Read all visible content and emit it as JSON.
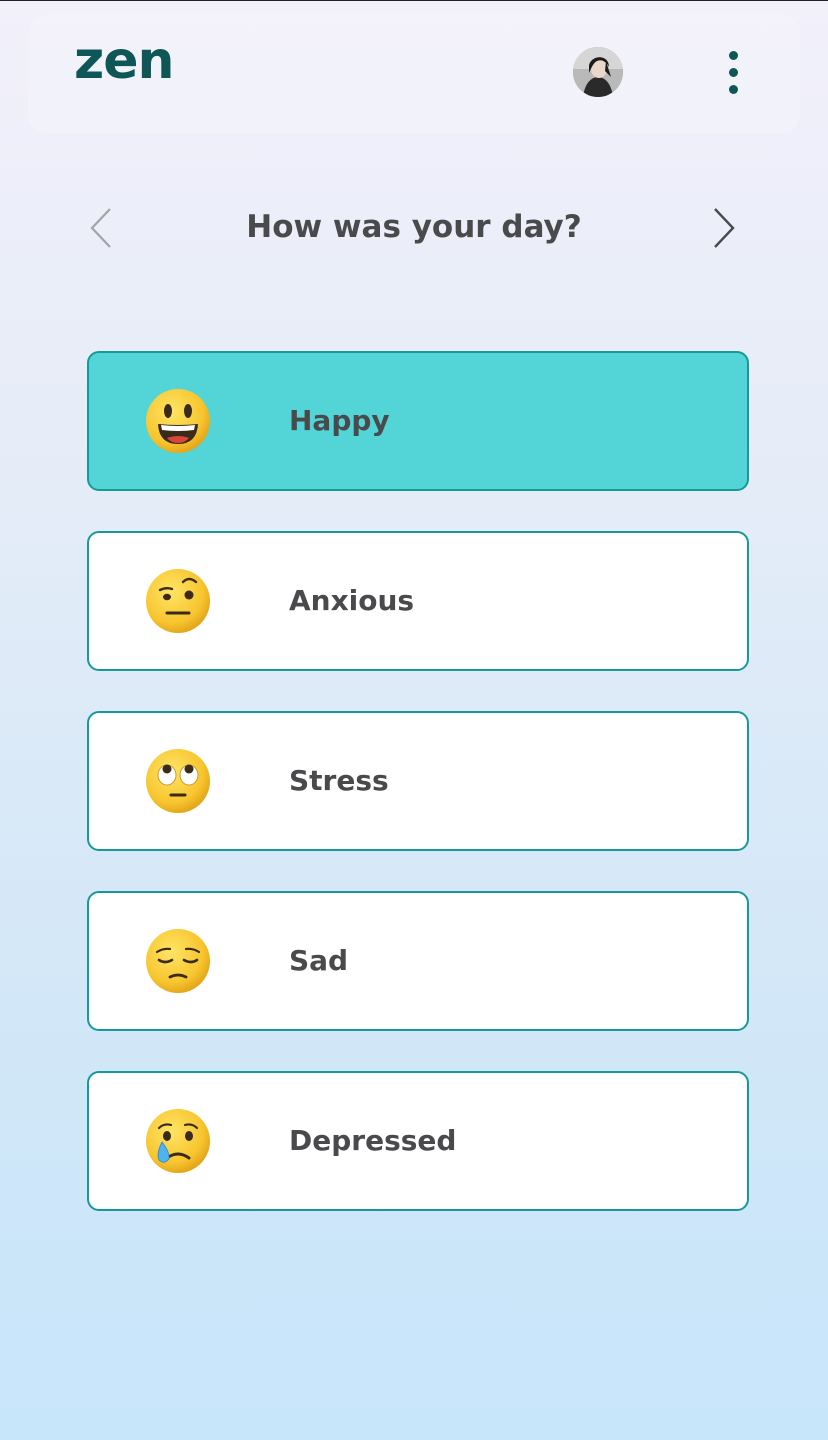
{
  "app": {
    "logo_text": "zen"
  },
  "header": {
    "avatar": "user-avatar-photo",
    "menu_icon": "kebab-menu-icon"
  },
  "prompt": {
    "question": "How was your day?",
    "prev_icon": "chevron-left-icon",
    "next_icon": "chevron-right-icon"
  },
  "moods": [
    {
      "label": "Happy",
      "icon": "grinning-face-emoji",
      "selected": true
    },
    {
      "label": "Anxious",
      "icon": "raised-eyebrow-face-emoji",
      "selected": false
    },
    {
      "label": "Stress",
      "icon": "rolling-eyes-face-emoji",
      "selected": false
    },
    {
      "label": "Sad",
      "icon": "pensive-face-emoji",
      "selected": false
    },
    {
      "label": "Depressed",
      "icon": "crying-face-emoji",
      "selected": false
    }
  ],
  "colors": {
    "brand": "#0f5657",
    "card_border": "#17999a",
    "selected_fill": "#53d5d7",
    "text": "#4a4a4d"
  }
}
